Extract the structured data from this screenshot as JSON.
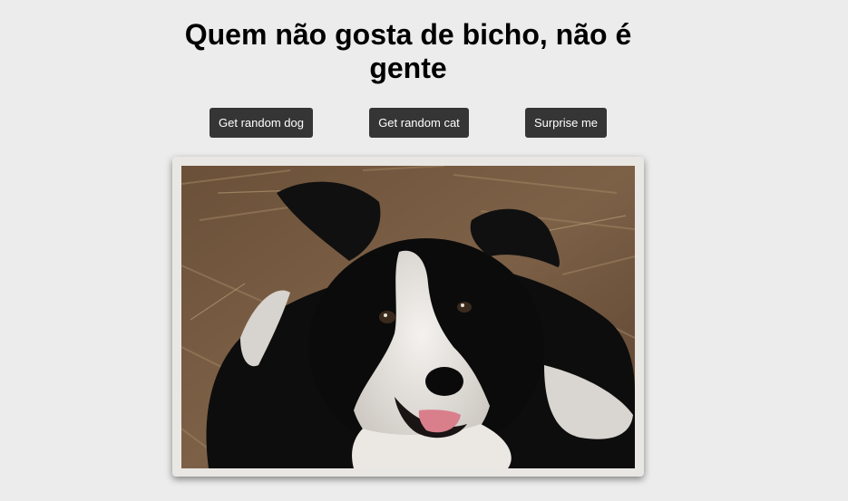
{
  "header": {
    "title": "Quem não gosta de bicho, não é gente"
  },
  "buttons": {
    "dog_label": "Get random dog",
    "cat_label": "Get random cat",
    "surprise_label": "Surprise me"
  },
  "photo": {
    "subject": "black-and-white border collie dog lying on straw"
  },
  "colors": {
    "background": "#ececec",
    "button_bg": "#353535",
    "button_text": "#ffffff"
  }
}
